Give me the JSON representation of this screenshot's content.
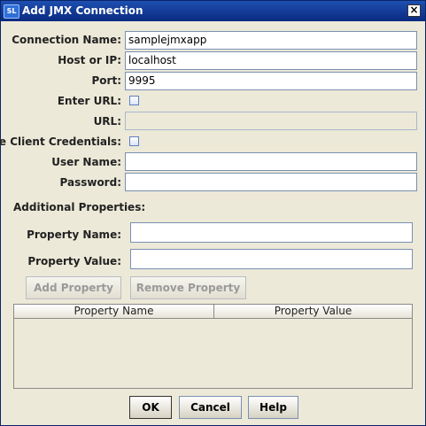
{
  "window": {
    "title": "Add JMX Connection",
    "icon_text": "SL",
    "close_glyph": "×"
  },
  "form": {
    "connection_name": {
      "label": "Connection Name:",
      "value": "samplejmxapp"
    },
    "host": {
      "label": "Host or IP:",
      "value": "localhost"
    },
    "port": {
      "label": "Port:",
      "value": "9995"
    },
    "enter_url": {
      "label": "Enter URL:",
      "checked": false
    },
    "url": {
      "label": "URL:",
      "value": "",
      "enabled": false
    },
    "use_client_credentials": {
      "label": "Use Client Credentials:",
      "checked": false
    },
    "user_name": {
      "label": "User Name:",
      "value": ""
    },
    "password": {
      "label": "Password:",
      "value": ""
    }
  },
  "additional": {
    "heading": "Additional Properties:",
    "property_name": {
      "label": "Property Name:",
      "value": ""
    },
    "property_value": {
      "label": "Property Value:",
      "value": ""
    },
    "add_button": "Add Property",
    "remove_button": "Remove Property",
    "table_headers": [
      "Property Name",
      "Property Value"
    ],
    "rows": []
  },
  "footer": {
    "ok": "OK",
    "cancel": "Cancel",
    "help": "Help"
  },
  "colors": {
    "titlebar": "#0a2a80",
    "background": "#ece9d8",
    "field_border": "#7a8fb0"
  }
}
